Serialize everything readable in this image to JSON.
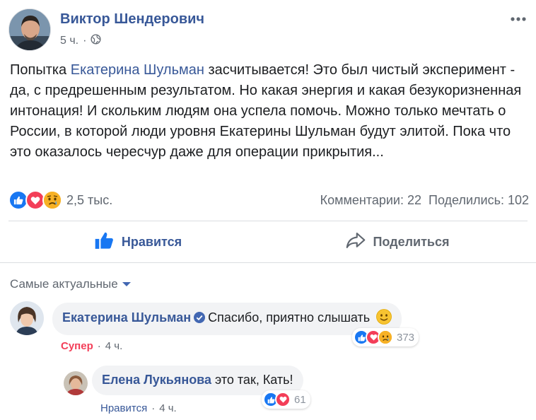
{
  "post": {
    "author": "Виктор Шендерович",
    "time": "5 ч.",
    "meta_separator": "·",
    "privacy_icon": "globe-icon",
    "body_pre": "Попытка ",
    "mention": "Екатерина Шульман",
    "body_post": " засчитывается! Это был чистый эксперимент - да, с предрешенным результатом. Но какая энергия и какая безукоризненная интонация! И скольким людям она успела помочь. Можно только мечтать о России, в которой люди уровня Екатерины Шульман будут элитой. Пока что это оказалось чересчур даже для операции прикрытия..."
  },
  "stats": {
    "reactions": [
      "like-icon",
      "love-icon",
      "sad-icon"
    ],
    "reaction_count": "2,5 тыс.",
    "comments": "Комментарии: 22",
    "shares": "Поделились: 102"
  },
  "actions": {
    "like": "Нравится",
    "share": "Поделиться"
  },
  "comments": {
    "sort_label": "Самые актуальные",
    "items": [
      {
        "name": "Екатерина Шульман",
        "verified": true,
        "text": "Спасибо, приятно слышать",
        "emoji": "smile-emoji",
        "reaction_label": "Супер",
        "time": "4 ч.",
        "reactions": [
          "like-icon",
          "love-icon",
          "sad-icon"
        ],
        "reaction_count": "373"
      },
      {
        "name": "Елена Лукьянова",
        "verified": false,
        "text": "это так, Кать!",
        "reaction_label": "Нравится",
        "time": "4 ч.",
        "reactions": [
          "like-icon",
          "love-icon"
        ],
        "reaction_count": "61"
      }
    ]
  },
  "colors": {
    "link": "#385898",
    "like_blue": "#1877f2",
    "love_red": "#f33e58",
    "sad_yellow": "#f7b125"
  }
}
